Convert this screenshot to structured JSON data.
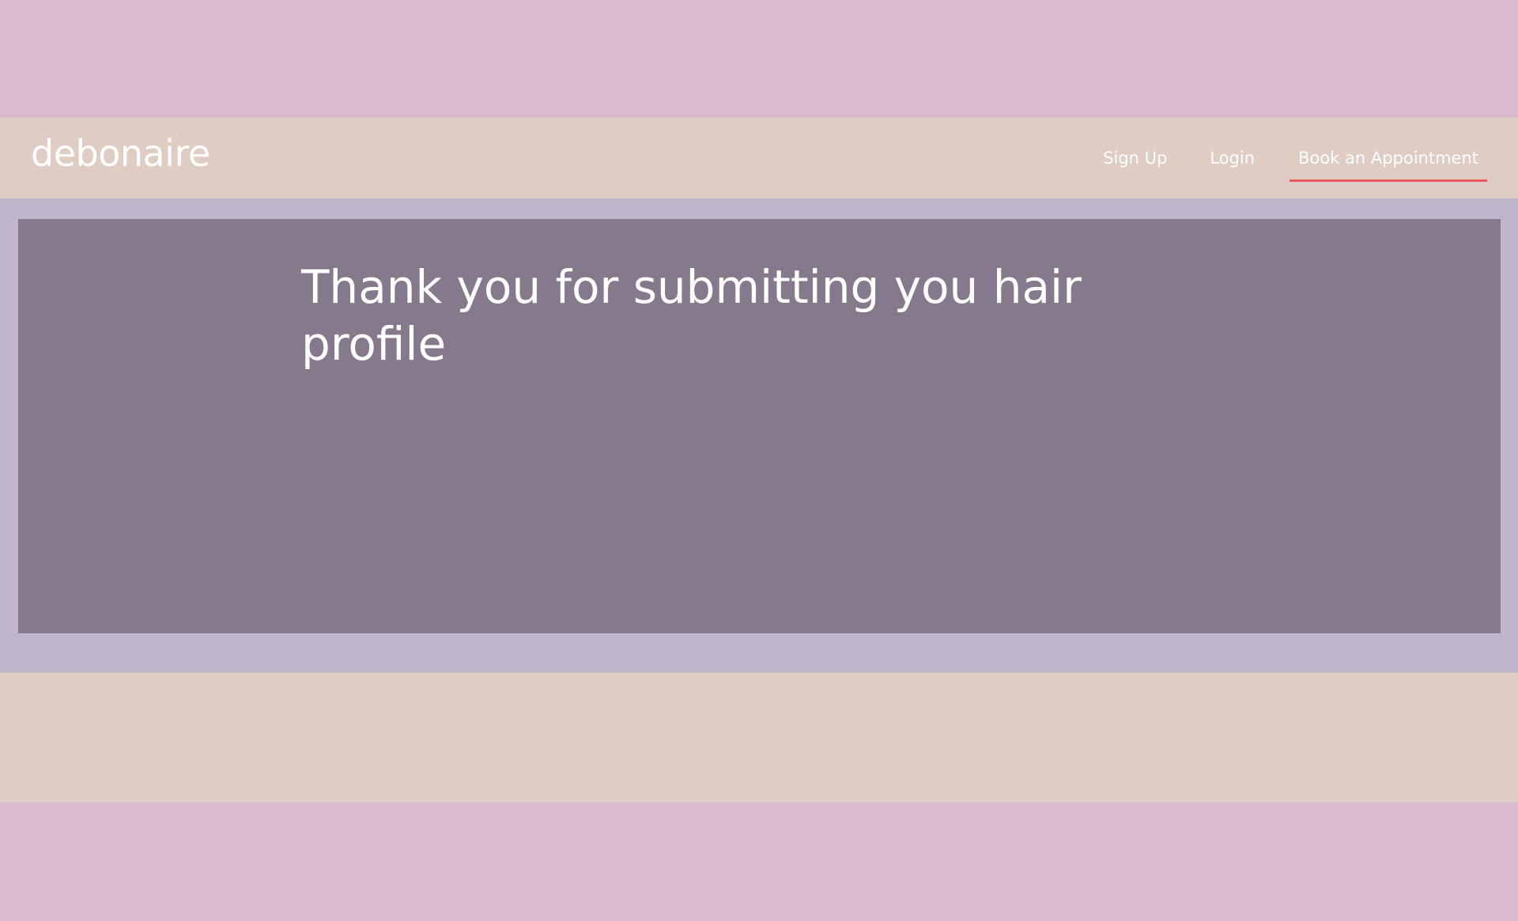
{
  "header": {
    "brand": "debonaire",
    "nav": {
      "sign_up": "Sign Up",
      "login": "Login",
      "book_appointment": "Book an Appointment"
    }
  },
  "main": {
    "message": "Thank you for submitting you hair profile"
  },
  "colors": {
    "page_background": "#dbb9cf",
    "header_background": "#dfccc2",
    "main_background": "#bfb6cb",
    "card_background": "#857a8b",
    "active_underline": "#e65a5e",
    "text": "#ffffff"
  }
}
